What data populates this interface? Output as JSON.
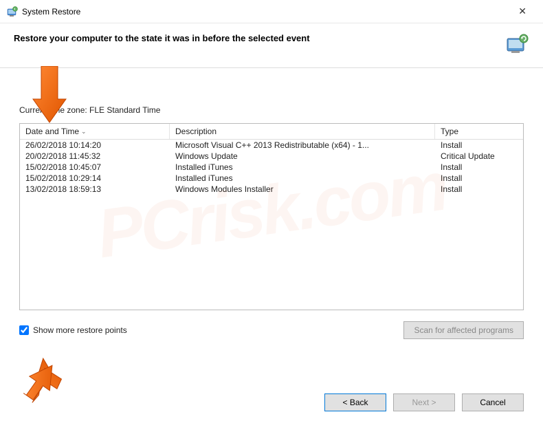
{
  "titlebar": {
    "title": "System Restore"
  },
  "header": {
    "text": "Restore your computer to the state it was in before the selected event"
  },
  "timezone_label": "Current time zone: FLE Standard Time",
  "columns": {
    "date": "Date and Time",
    "desc": "Description",
    "type": "Type"
  },
  "rows": [
    {
      "date": "26/02/2018 10:14:20",
      "desc": "Microsoft Visual C++ 2013 Redistributable (x64) - 1...",
      "type": "Install"
    },
    {
      "date": "20/02/2018 11:45:32",
      "desc": "Windows Update",
      "type": "Critical Update"
    },
    {
      "date": "15/02/2018 10:45:07",
      "desc": "Installed iTunes",
      "type": "Install"
    },
    {
      "date": "15/02/2018 10:29:14",
      "desc": "Installed iTunes",
      "type": "Install"
    },
    {
      "date": "13/02/2018 18:59:13",
      "desc": "Windows Modules Installer",
      "type": "Install"
    }
  ],
  "checkbox": {
    "label": "Show more restore points",
    "checked": true
  },
  "buttons": {
    "scan": "Scan for affected programs",
    "back": "< Back",
    "next": "Next >",
    "cancel": "Cancel"
  }
}
